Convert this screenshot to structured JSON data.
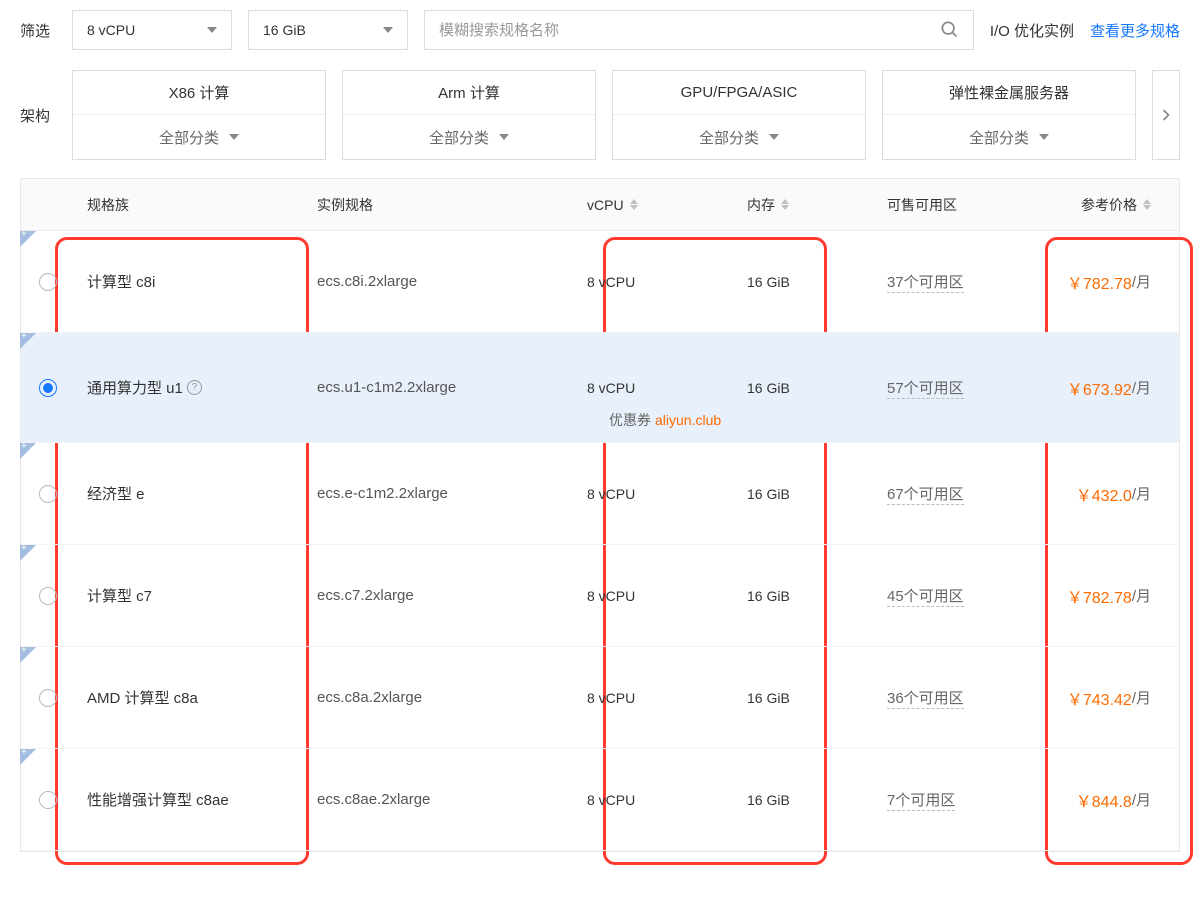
{
  "filter": {
    "label": "筛选",
    "vcpu_selected": "8 vCPU",
    "mem_selected": "16 GiB",
    "search_placeholder": "模糊搜索规格名称",
    "io_label": "I/O 优化实例",
    "more_link": "查看更多规格"
  },
  "arch": {
    "label": "架构",
    "all_category": "全部分类",
    "cards": [
      {
        "title": "X86 计算"
      },
      {
        "title": "Arm 计算"
      },
      {
        "title": "GPU/FPGA/ASIC"
      },
      {
        "title": "弹性裸金属服务器"
      }
    ]
  },
  "table": {
    "headers": {
      "family": "规格族",
      "spec": "实例规格",
      "vcpu": "vCPU",
      "mem": "内存",
      "zone": "可售可用区",
      "price": "参考价格"
    },
    "rows": [
      {
        "family": "计算型 c8i",
        "help": false,
        "spec": "ecs.c8i.2xlarge",
        "vcpu": "8 vCPU",
        "mem": "16 GiB",
        "zone": "37个可用区",
        "price": "￥782.78",
        "suffix": "/月",
        "selected": false
      },
      {
        "family": "通用算力型 u1",
        "help": true,
        "spec": "ecs.u1-c1m2.2xlarge",
        "vcpu": "8 vCPU",
        "mem": "16 GiB",
        "zone": "57个可用区",
        "price": "￥673.92",
        "suffix": "/月",
        "selected": true
      },
      {
        "family": "经济型 e",
        "help": false,
        "spec": "ecs.e-c1m2.2xlarge",
        "vcpu": "8 vCPU",
        "mem": "16 GiB",
        "zone": "67个可用区",
        "price": "￥432.0",
        "suffix": "/月",
        "selected": false
      },
      {
        "family": "计算型 c7",
        "help": false,
        "spec": "ecs.c7.2xlarge",
        "vcpu": "8 vCPU",
        "mem": "16 GiB",
        "zone": "45个可用区",
        "price": "￥782.78",
        "suffix": "/月",
        "selected": false
      },
      {
        "family": "AMD 计算型 c8a",
        "help": false,
        "spec": "ecs.c8a.2xlarge",
        "vcpu": "8 vCPU",
        "mem": "16 GiB",
        "zone": "36个可用区",
        "price": "￥743.42",
        "suffix": "/月",
        "selected": false
      },
      {
        "family": "性能增强计算型 c8ae",
        "help": false,
        "spec": "ecs.c8ae.2xlarge",
        "vcpu": "8 vCPU",
        "mem": "16 GiB",
        "zone": "7个可用区",
        "price": "￥844.8",
        "suffix": "/月",
        "selected": false
      }
    ],
    "coupon": {
      "label": "优惠券",
      "url": "aliyun.club"
    }
  }
}
